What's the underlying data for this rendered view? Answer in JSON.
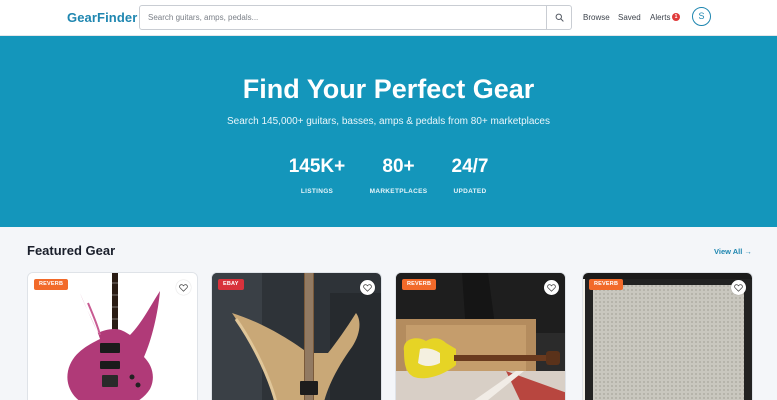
{
  "header": {
    "logo": "GearFinder",
    "search": {
      "placeholder": "Search guitars, amps, pedals...",
      "value": ""
    },
    "nav": {
      "browse": "Browse",
      "saved": "Saved",
      "alerts": "Alerts",
      "alerts_count": "1"
    },
    "avatar_initial": "S"
  },
  "hero": {
    "title": "Find Your Perfect Gear",
    "subtitle": "Search 145,000+ guitars, basses, amps & pedals from 80+ marketplaces",
    "stats": [
      {
        "value": "145K+",
        "label": "LISTINGS"
      },
      {
        "value": "80+",
        "label": "MARKETPLACES"
      },
      {
        "value": "24/7",
        "label": "UPDATED"
      }
    ]
  },
  "featured": {
    "title": "Featured Gear",
    "view_all": "View All →",
    "cards": [
      {
        "source": "REVERB",
        "image": "pink electric guitar"
      },
      {
        "source": "EBAY",
        "image": "natural wood bass guitar"
      },
      {
        "source": "REVERB",
        "image": "yellow electric guitar"
      },
      {
        "source": "REVERB",
        "image": "guitar amplifier grille"
      }
    ]
  },
  "colors": {
    "brand": "#1e86b0",
    "hero_bg": "#1496bb",
    "reverb_badge": "#f26a2a",
    "ebay_badge": "#d8323c",
    "alert_badge": "#e03b3b"
  },
  "icons": {
    "search_button": "search-icon",
    "favorite": "heart-icon"
  }
}
